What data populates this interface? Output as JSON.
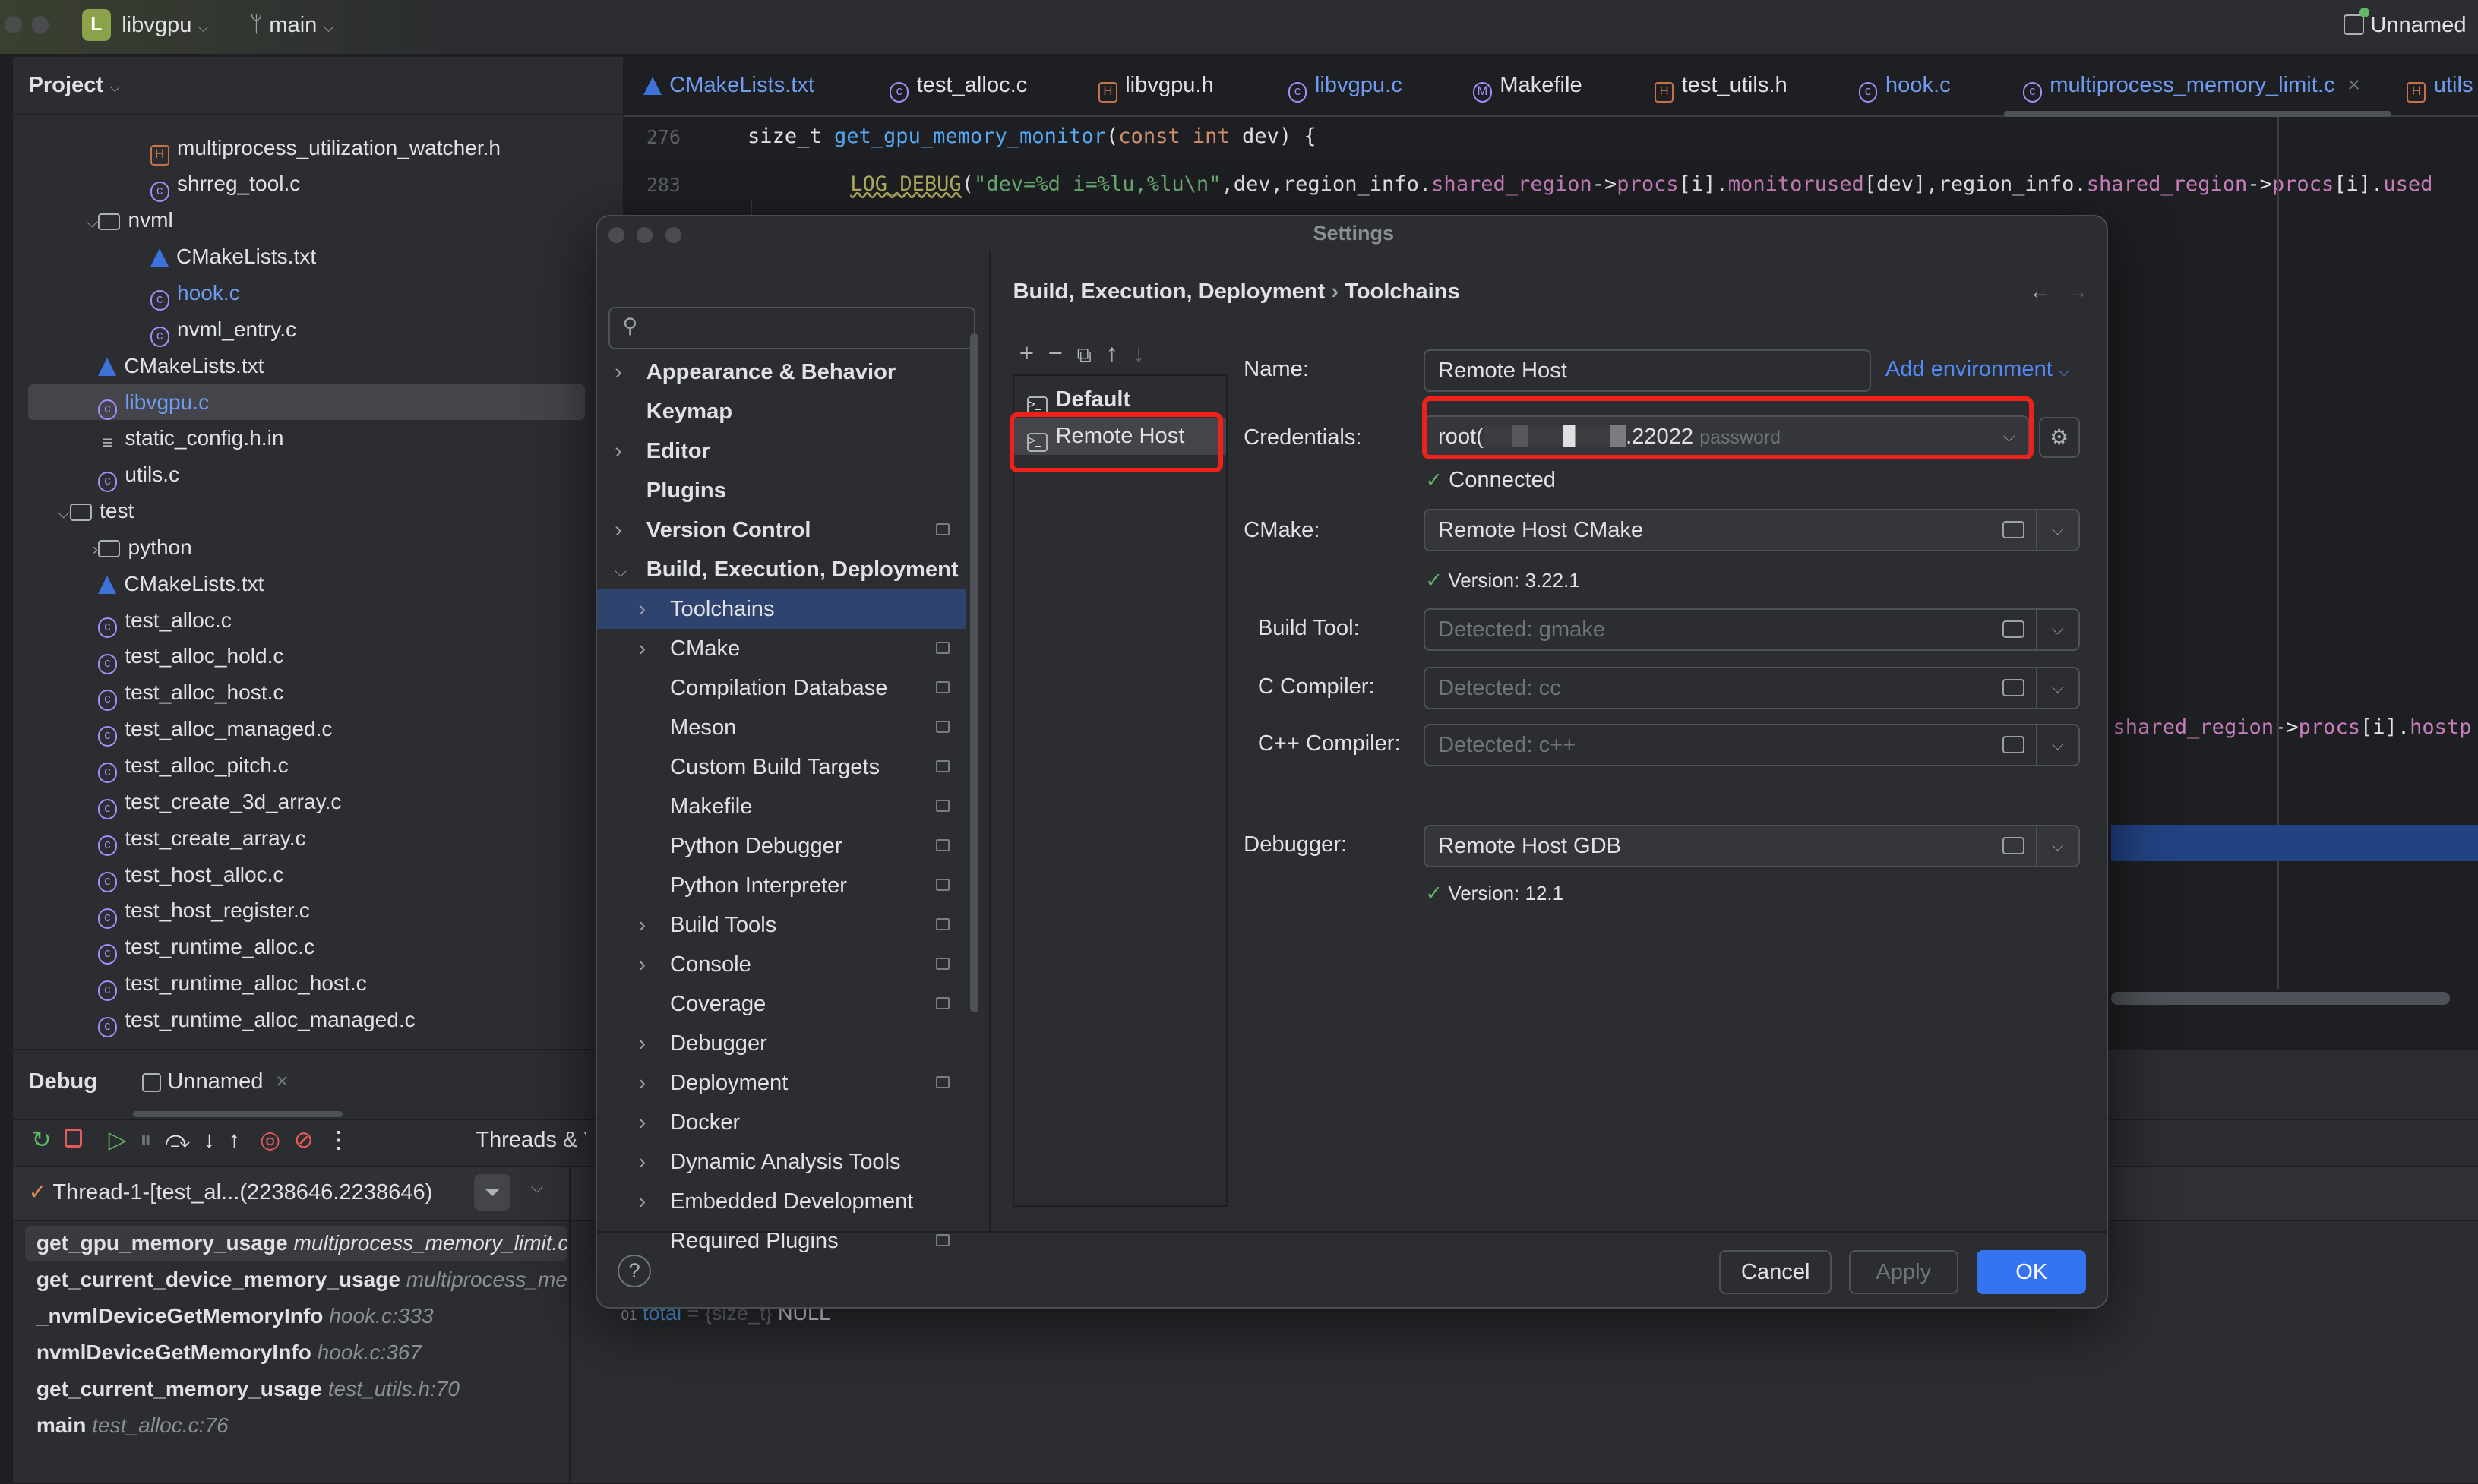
{
  "titlebar": {
    "project_initial": "L",
    "project": "libvgpu",
    "branch": "main",
    "run_config": "Unnamed"
  },
  "project_panel": {
    "title": "Project",
    "items": [
      {
        "label": "multiprocess_utilization_watcher.h",
        "icon": "h",
        "indent": 2
      },
      {
        "label": "shrreg_tool.c",
        "icon": "c",
        "indent": 2
      },
      {
        "label": "nvml",
        "icon": "folder",
        "indent": 1,
        "chevron": "down"
      },
      {
        "label": "CMakeLists.txt",
        "icon": "cmake",
        "indent": 2
      },
      {
        "label": "hook.c",
        "icon": "c",
        "indent": 2,
        "color": "#6f9cf0"
      },
      {
        "label": "nvml_entry.c",
        "icon": "c",
        "indent": 2
      },
      {
        "label": "CMakeLists.txt",
        "icon": "cmake",
        "indent": 1
      },
      {
        "label": "libvgpu.c",
        "icon": "c",
        "indent": 1,
        "selected": true,
        "color": "#6f9cf0"
      },
      {
        "label": "static_config.h.in",
        "icon": "txt",
        "indent": 1
      },
      {
        "label": "utils.c",
        "icon": "c",
        "indent": 1
      },
      {
        "label": "test",
        "icon": "folder",
        "indent": 0,
        "chevron": "down"
      },
      {
        "label": "python",
        "icon": "folder",
        "indent": 1,
        "chevron": "right"
      },
      {
        "label": "CMakeLists.txt",
        "icon": "cmake",
        "indent": 1
      },
      {
        "label": "test_alloc.c",
        "icon": "c",
        "indent": 1
      },
      {
        "label": "test_alloc_hold.c",
        "icon": "c",
        "indent": 1
      },
      {
        "label": "test_alloc_host.c",
        "icon": "c",
        "indent": 1
      },
      {
        "label": "test_alloc_managed.c",
        "icon": "c",
        "indent": 1
      },
      {
        "label": "test_alloc_pitch.c",
        "icon": "c",
        "indent": 1
      },
      {
        "label": "test_create_3d_array.c",
        "icon": "c",
        "indent": 1
      },
      {
        "label": "test_create_array.c",
        "icon": "c",
        "indent": 1
      },
      {
        "label": "test_host_alloc.c",
        "icon": "c",
        "indent": 1
      },
      {
        "label": "test_host_register.c",
        "icon": "c",
        "indent": 1
      },
      {
        "label": "test_runtime_alloc.c",
        "icon": "c",
        "indent": 1
      },
      {
        "label": "test_runtime_alloc_host.c",
        "icon": "c",
        "indent": 1
      },
      {
        "label": "test_runtime_alloc_managed.c",
        "icon": "c",
        "indent": 1
      }
    ]
  },
  "editor": {
    "tabs": [
      {
        "label": "CMakeLists.txt",
        "icon": "cmake",
        "blue": true
      },
      {
        "label": "test_alloc.c",
        "icon": "c"
      },
      {
        "label": "libvgpu.h",
        "icon": "h"
      },
      {
        "label": "libvgpu.c",
        "icon": "c",
        "blue": true
      },
      {
        "label": "Makefile",
        "icon": "makefile"
      },
      {
        "label": "test_utils.h",
        "icon": "h"
      },
      {
        "label": "hook.c",
        "icon": "c",
        "blue": true
      },
      {
        "label": "multiprocess_memory_limit.c",
        "icon": "c",
        "blue": true,
        "active": true
      },
      {
        "label": "utils",
        "icon": "h",
        "blue": true
      }
    ],
    "lines": [
      {
        "num": "276",
        "parts": [
          [
            "",
            "size_t "
          ],
          [
            "fn",
            "get_gpu_memory_monitor"
          ],
          [
            "",
            "("
          ],
          [
            "kw",
            "const int"
          ],
          [
            "",
            " dev) {"
          ]
        ]
      },
      {
        "num": "283",
        "parts": [
          [
            "mac",
            "LOG_DEBUG"
          ],
          [
            "",
            "("
          ],
          [
            "str",
            "\"dev=%d i=%lu,%lu\\n\""
          ],
          [
            "",
            ",dev,region_info."
          ],
          [
            "fld",
            "shared_region"
          ],
          [
            "",
            "->"
          ],
          [
            "fld",
            "procs"
          ],
          [
            "",
            "[i]."
          ],
          [
            "fld",
            "monitorused"
          ],
          [
            "",
            "[dev],region_info."
          ],
          [
            "fld",
            "shared_region"
          ],
          [
            "",
            "->"
          ],
          [
            "fld",
            "procs"
          ],
          [
            "",
            "[i]."
          ],
          [
            "fld",
            "used"
          ]
        ]
      }
    ],
    "fragment": [
      [
        "fld",
        "shared_region"
      ],
      [
        "",
        "->"
      ],
      [
        "fld",
        "procs"
      ],
      [
        "",
        "[i]."
      ],
      [
        "fld",
        "hostp"
      ]
    ]
  },
  "debug": {
    "title": "Debug",
    "session_tab": "Unnamed",
    "threads_tab": "Threads & Variables",
    "thread": "Thread-1-[test_al...(2238646.2238646)",
    "frames": [
      {
        "fn": "get_gpu_memory_usage",
        "loc": "multiprocess_memory_limit.c"
      },
      {
        "fn": "get_current_device_memory_usage",
        "loc": "multiprocess_memory_limit.c"
      },
      {
        "fn": "_nvmlDeviceGetMemoryInfo",
        "loc": "hook.c:333"
      },
      {
        "fn": "nvmlDeviceGetMemoryInfo",
        "loc": "hook.c:367"
      },
      {
        "fn": "get_current_memory_usage",
        "loc": "test_utils.h:70"
      },
      {
        "fn": "main",
        "loc": "test_alloc.c:76"
      }
    ],
    "variable": {
      "name": "total",
      "type": "= {size_t}",
      "value": "NULL"
    }
  },
  "settings": {
    "title": "Settings",
    "search_placeholder": "",
    "breadcrumb": [
      "Build, Execution, Deployment",
      "Toolchains"
    ],
    "tree": [
      {
        "label": "Appearance & Behavior",
        "bold": true,
        "chevron": "right",
        "indent": 0
      },
      {
        "label": "Keymap",
        "bold": true,
        "indent": 0
      },
      {
        "label": "Editor",
        "bold": true,
        "chevron": "right",
        "indent": 0
      },
      {
        "label": "Plugins",
        "bold": true,
        "indent": 0
      },
      {
        "label": "Version Control",
        "bold": true,
        "chevron": "right",
        "indent": 0,
        "project": true
      },
      {
        "label": "Build, Execution, Deployment",
        "bold": true,
        "chevron": "down",
        "indent": 0
      },
      {
        "label": "Toolchains",
        "chevron": "right",
        "indent": 1,
        "selected": true
      },
      {
        "label": "CMake",
        "chevron": "right",
        "indent": 1,
        "project": true
      },
      {
        "label": "Compilation Database",
        "indent": 1,
        "project": true
      },
      {
        "label": "Meson",
        "indent": 1,
        "project": true
      },
      {
        "label": "Custom Build Targets",
        "indent": 1,
        "project": true
      },
      {
        "label": "Makefile",
        "indent": 1,
        "project": true
      },
      {
        "label": "Python Debugger",
        "indent": 1,
        "project": true
      },
      {
        "label": "Python Interpreter",
        "indent": 1,
        "project": true
      },
      {
        "label": "Build Tools",
        "chevron": "right",
        "indent": 1,
        "project": true
      },
      {
        "label": "Console",
        "chevron": "right",
        "indent": 1,
        "project": true
      },
      {
        "label": "Coverage",
        "indent": 1,
        "project": true
      },
      {
        "label": "Debugger",
        "chevron": "right",
        "indent": 1
      },
      {
        "label": "Deployment",
        "chevron": "right",
        "indent": 1,
        "project": true
      },
      {
        "label": "Docker",
        "chevron": "right",
        "indent": 1
      },
      {
        "label": "Dynamic Analysis Tools",
        "chevron": "right",
        "indent": 1
      },
      {
        "label": "Embedded Development",
        "chevron": "right",
        "indent": 1
      },
      {
        "label": "Required Plugins",
        "indent": 1,
        "project": true
      }
    ],
    "toolchains": [
      {
        "label": "Default",
        "bold": true
      },
      {
        "label": "Remote Host",
        "selected": true
      }
    ],
    "form": {
      "name_label": "Name:",
      "name_value": "Remote Host",
      "add_env": "Add environment",
      "credentials_label": "Credentials:",
      "credentials_value": "root(",
      "credentials_suffix": ".22022",
      "credentials_hint": "password",
      "connected": "Connected",
      "cmake_label": "CMake:",
      "cmake_value": "Remote Host CMake",
      "cmake_version": "Version: 3.22.1",
      "build_tool_label": "Build Tool:",
      "build_tool_placeholder": "Detected: gmake",
      "c_label": "C Compiler:",
      "c_placeholder": "Detected: cc",
      "cpp_label": "C++ Compiler:",
      "cpp_placeholder": "Detected: c++",
      "debugger_label": "Debugger:",
      "debugger_value": "Remote Host GDB",
      "debugger_version": "Version: 12.1"
    },
    "buttons": {
      "help": "?",
      "cancel": "Cancel",
      "apply": "Apply",
      "ok": "OK"
    },
    "colors": {
      "accent": "#3574f0",
      "highlight_box": "#f0201b",
      "success": "#5fb865"
    }
  }
}
